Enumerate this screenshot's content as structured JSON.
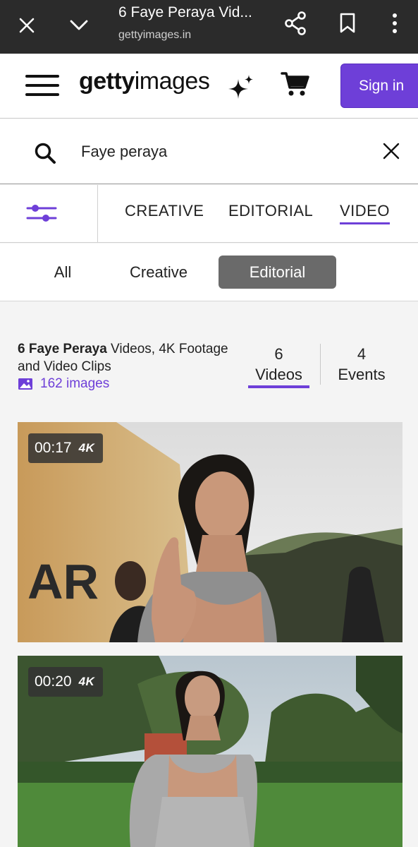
{
  "browser": {
    "title": "6 Faye Peraya Vid...",
    "url": "gettyimages.in"
  },
  "header": {
    "logo_bold": "getty",
    "logo_light": "images",
    "signin_label": "Sign in"
  },
  "search": {
    "value": "Faye peraya"
  },
  "tabs": [
    {
      "label": "CREATIVE",
      "active": false
    },
    {
      "label": "EDITORIAL",
      "active": false
    },
    {
      "label": "VIDEO",
      "active": true
    }
  ],
  "segments": [
    {
      "label": "All",
      "selected": false
    },
    {
      "label": "Creative",
      "selected": false
    },
    {
      "label": "Editorial",
      "selected": true
    }
  ],
  "results": {
    "title_bold": "6 Faye Peraya",
    "title_rest": " Videos, 4K Footage and Video Clips",
    "images_count": "162 images",
    "videos_count": "6",
    "videos_label": "Videos",
    "events_count": "4",
    "events_label": "Events"
  },
  "videos": [
    {
      "duration": "00:17",
      "quality": "4K"
    },
    {
      "duration": "00:20",
      "quality": "4K"
    }
  ],
  "colors": {
    "accent": "#6e3fd8",
    "browser_bar": "#2b2b2b",
    "selected_segment": "#6a6a6a"
  }
}
